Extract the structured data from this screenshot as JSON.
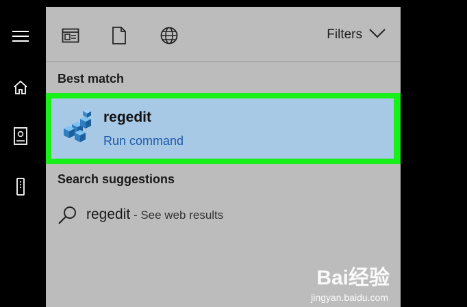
{
  "sidebar": {
    "items": [
      {
        "icon": "hamburger-menu-icon"
      },
      {
        "icon": "home-icon"
      },
      {
        "icon": "notebook-icon"
      },
      {
        "icon": "tower-device-icon"
      }
    ]
  },
  "toolbar": {
    "filters_label": "Filters",
    "icons": [
      "apps-icon",
      "document-icon",
      "web-globe-icon",
      "chevron-down-icon"
    ]
  },
  "best_match": {
    "title": "Best match",
    "app_name": "regedit",
    "app_subtitle": "Run command",
    "highlight_color": "#19ef19",
    "selected_bg": "#a8c9e6"
  },
  "search_suggestions": {
    "title": "Search suggestions",
    "items": [
      {
        "query": "regedit",
        "suffix": " - See web results"
      }
    ]
  },
  "watermark": {
    "logo_text": "Bai经验",
    "url": "jingyan.baidu.com"
  },
  "colors": {
    "panel_bg": "#bcbcbc",
    "sidebar_bg": "#000000",
    "link_blue": "#1e5aa8"
  }
}
